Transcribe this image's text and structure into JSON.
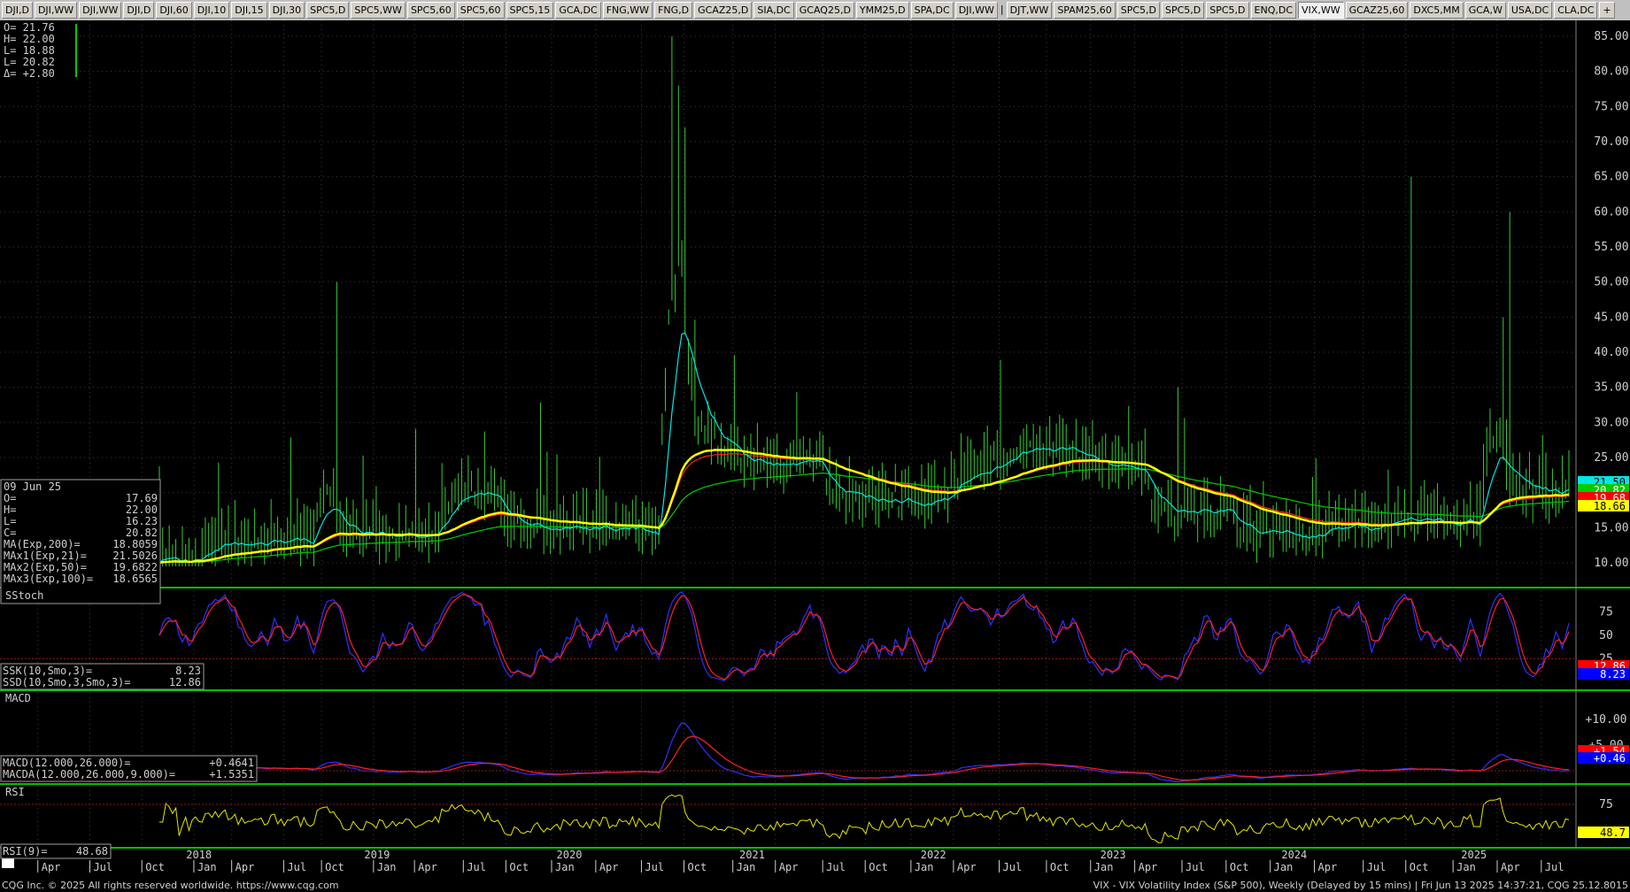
{
  "tabs": [
    {
      "label": "DJI,D"
    },
    {
      "label": "DJI,WW"
    },
    {
      "label": "DJI,WW"
    },
    {
      "label": "DJI,D"
    },
    {
      "label": "DJI,60"
    },
    {
      "label": "DJI,10"
    },
    {
      "label": "DJI,15"
    },
    {
      "label": "DJI,30"
    },
    {
      "label": "SPC5,D"
    },
    {
      "label": "SPC5,WW"
    },
    {
      "label": "SPC5,60"
    },
    {
      "label": "SPC5,60"
    },
    {
      "label": "SPC5,15"
    },
    {
      "label": "GCA,DC"
    },
    {
      "label": "FNG,WW"
    },
    {
      "label": "FNG,D"
    },
    {
      "label": "GCAZ25,D"
    },
    {
      "label": "SIA,DC"
    },
    {
      "label": "GCAQ25,D"
    },
    {
      "label": "YMM25,D"
    },
    {
      "label": "SPA,DC"
    },
    {
      "label": "DJI,WW"
    },
    {
      "label": "|",
      "sep": true
    },
    {
      "label": "DJT,WW"
    },
    {
      "label": "SPAM25,60"
    },
    {
      "label": "SPC5,D"
    },
    {
      "label": "SPC5,D"
    },
    {
      "label": "SPC5,D"
    },
    {
      "label": "ENQ,DC"
    },
    {
      "label": "VIX,WW",
      "active": true
    },
    {
      "label": "GCAZ25,60"
    },
    {
      "label": "DXC5,MM"
    },
    {
      "label": "GCA,W"
    },
    {
      "label": "USA,DC"
    },
    {
      "label": "CLA,DC"
    },
    {
      "label": "+"
    }
  ],
  "cursor_box": {
    "lines": [
      "O=  21.76",
      "H=  22.00",
      "L=  18.88",
      "L=  20.82",
      "Δ=  +2.80"
    ]
  },
  "info_box": {
    "date": "09 Jun 25",
    "rows": [
      {
        "label": "O=",
        "value": "17.69"
      },
      {
        "label": "H=",
        "value": "22.00"
      },
      {
        "label": "L=",
        "value": "16.23"
      },
      {
        "label": "C=",
        "value": "20.82"
      },
      {
        "label": "MA(Exp,200)=",
        "value": "18.8059"
      },
      {
        "label": "MAx1(Exp,21)=",
        "value": "21.5026"
      },
      {
        "label": "MAx2(Exp,50)=",
        "value": "19.6822"
      },
      {
        "label": "MAx3(Exp,100)=",
        "value": "18.6565"
      }
    ]
  },
  "panels": {
    "price": {
      "axis_labels": [
        "85.00",
        "80.00",
        "75.00",
        "70.00",
        "65.00",
        "60.00",
        "55.00",
        "50.00",
        "45.00",
        "40.00",
        "35.00",
        "30.00",
        "25.00",
        "20.00",
        "15.00",
        "10.00"
      ],
      "tags": [
        {
          "text": "21.50",
          "bg": "#00e6e6",
          "fg": "#000000"
        },
        {
          "text": "20.82",
          "bg": "#00cc00",
          "fg": "#ffffff"
        },
        {
          "text": "19.68",
          "bg": "#ff0000",
          "fg": "#ffffff"
        },
        {
          "text": "18.66",
          "bg": "#ffff00",
          "fg": "#000000"
        }
      ]
    },
    "sstoch": {
      "title": "SStoch",
      "axis_labels": [
        "75",
        "50",
        "25"
      ],
      "legend": [
        {
          "label": "SSK(10,Smo,3)=",
          "value": "8.23"
        },
        {
          "label": "SSD(10,Smo,3,Smo,3)=",
          "value": "12.86"
        }
      ],
      "tags": [
        {
          "text": "12.86",
          "bg": "#ff0000",
          "fg": "#ffffff"
        },
        {
          "text": "8.23",
          "bg": "#0000ff",
          "fg": "#ffffff"
        }
      ]
    },
    "macd": {
      "title": "MACD",
      "axis_labels": [
        "+10.00",
        "+5.00"
      ],
      "legend": [
        {
          "label": "MACD(12.000,26.000)=",
          "value": "+0.4641"
        },
        {
          "label": "MACDA(12.000,26.000,9.000)=",
          "value": "+1.5351"
        }
      ],
      "tags": [
        {
          "text": "+1.54",
          "bg": "#ff0000",
          "fg": "#ffffff"
        },
        {
          "text": "+0.46",
          "bg": "#0000ff",
          "fg": "#ffffff"
        }
      ]
    },
    "rsi": {
      "title": "RSI",
      "axis_labels": [
        "75"
      ],
      "legend": [
        {
          "label": "RSI(9)=",
          "value": "48.68"
        }
      ],
      "tags": [
        {
          "text": "48.7",
          "bg": "#ffff00",
          "fg": "#000000"
        }
      ]
    }
  },
  "time_axis": {
    "months": [
      {
        "label": "Apr",
        "x": 0.024
      },
      {
        "label": "Jul",
        "x": 0.057
      },
      {
        "label": "Oct",
        "x": 0.09
      },
      {
        "label": "Jan",
        "x": 0.123
      },
      {
        "label": "Apr",
        "x": 0.147
      },
      {
        "label": "Jul",
        "x": 0.18
      },
      {
        "label": "Oct",
        "x": 0.204
      },
      {
        "label": "Jan",
        "x": 0.237
      },
      {
        "label": "Apr",
        "x": 0.263
      },
      {
        "label": "Jul",
        "x": 0.294
      },
      {
        "label": "Oct",
        "x": 0.321
      },
      {
        "label": "Jan",
        "x": 0.35
      },
      {
        "label": "Apr",
        "x": 0.378
      },
      {
        "label": "Jul",
        "x": 0.407
      },
      {
        "label": "Oct",
        "x": 0.434
      },
      {
        "label": "Jan",
        "x": 0.465
      },
      {
        "label": "Apr",
        "x": 0.492
      },
      {
        "label": "Jul",
        "x": 0.522
      },
      {
        "label": "Oct",
        "x": 0.549
      },
      {
        "label": "Jan",
        "x": 0.578
      },
      {
        "label": "Apr",
        "x": 0.605
      },
      {
        "label": "Jul",
        "x": 0.634
      },
      {
        "label": "Oct",
        "x": 0.664
      },
      {
        "label": "Jan",
        "x": 0.692
      },
      {
        "label": "Apr",
        "x": 0.72
      },
      {
        "label": "Jul",
        "x": 0.75
      },
      {
        "label": "Oct",
        "x": 0.778
      },
      {
        "label": "Jan",
        "x": 0.806
      },
      {
        "label": "Apr",
        "x": 0.834
      },
      {
        "label": "Jul",
        "x": 0.865
      },
      {
        "label": "Oct",
        "x": 0.892
      },
      {
        "label": "Jan",
        "x": 0.922
      },
      {
        "label": "Apr",
        "x": 0.95
      },
      {
        "label": "Jul",
        "x": 0.978
      }
    ],
    "years": [
      {
        "label": "2018",
        "x": 0.117
      },
      {
        "label": "2019",
        "x": 0.23
      },
      {
        "label": "2020",
        "x": 0.352
      },
      {
        "label": "2021",
        "x": 0.468
      },
      {
        "label": "2022",
        "x": 0.583
      },
      {
        "label": "2023",
        "x": 0.697
      },
      {
        "label": "2024",
        "x": 0.812
      },
      {
        "label": "2025",
        "x": 0.926
      }
    ]
  },
  "series_colors": {
    "price_bars": "#33cc33",
    "ma200": "#ffff00",
    "ema21": "#00e6e6",
    "ema50": "#ff2020",
    "ema100": "#00cc00",
    "ssk": "#3030ff",
    "ssd": "#ff2020",
    "macd": "#3030ff",
    "macda": "#ff2020",
    "rsi": "#e6e600",
    "divider": "#00c000"
  },
  "footer": {
    "left": "CQG Inc. © 2025 All rights reserved worldwide. https://www.cqg.com",
    "right": "VIX - VIX Volatility Index (S&P 500), Weekly (Delayed by 15 mins) | Fri Jun 13 2025 14:37:21, CQG 25.12.8015"
  }
}
